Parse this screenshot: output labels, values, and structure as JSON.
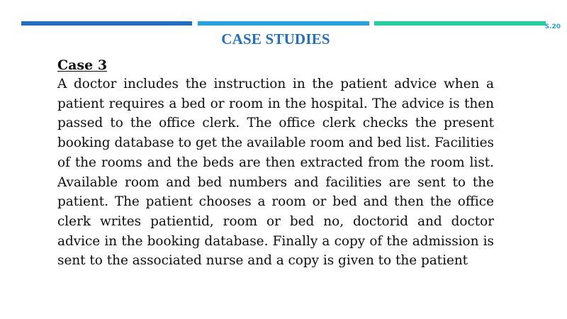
{
  "colors": {
    "bar_1": "#1f6fc5",
    "bar_2": "#23a4e0",
    "bar_3": "#1fcf9f",
    "title": "#1f6fc5",
    "slide_number": "#23a4e0"
  },
  "slide": {
    "number": "S.20",
    "title": "CASE STUDIES"
  },
  "case": {
    "heading": "Case 3",
    "body": "A doctor includes the instruction in the patient advice when a patient requires a bed or room in the hospital. The advice is then passed to the office clerk. The office clerk checks the present booking database to get the available room and bed list. Facilities of the rooms and the beds are then extracted from the room list. Available room and bed numbers and facilities are sent to the patient. The patient chooses a room or bed and then the office clerk writes patientid, room or bed no, doctorid and doctor advice in the booking database. Finally a copy of the admission is sent to the associated nurse and a copy is given to the patient"
  }
}
